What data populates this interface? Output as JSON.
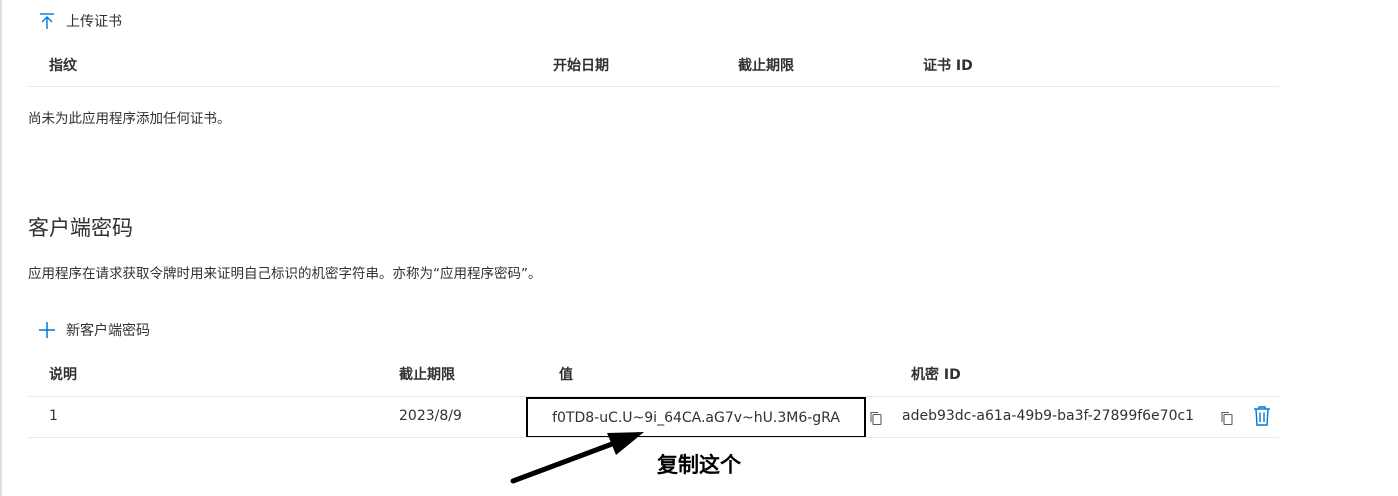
{
  "certificates": {
    "upload_label": "上传证书",
    "columns": [
      "指纹",
      "开始日期",
      "截止期限",
      "证书 ID"
    ],
    "empty_message": "尚未为此应用程序添加任何证书。"
  },
  "client_secrets": {
    "title": "客户端密码",
    "description": "应用程序在请求获取令牌时用来证明自己标识的机密字符串。亦称为“应用程序密码”。",
    "new_label": "新客户端密码",
    "columns": [
      "说明",
      "截止期限",
      "值",
      "机密 ID"
    ],
    "rows": [
      {
        "description": "1",
        "expires": "2023/8/9",
        "value": "f0TD8-uC.U~9i_64CA.aG7v~hU.3M6-gRA",
        "secret_id": "adeb93dc-a61a-49b9-ba3f-27899f6e70c1"
      }
    ]
  },
  "annotation": {
    "text": "复制这个",
    "color": "#000000"
  },
  "colors": {
    "accent": "#0078d4",
    "text": "#323130",
    "divider": "#edebe9"
  },
  "icons": {
    "upload": "upload-arrow-icon",
    "add": "plus-icon",
    "copy": "copy-icon",
    "delete": "trash-icon"
  }
}
